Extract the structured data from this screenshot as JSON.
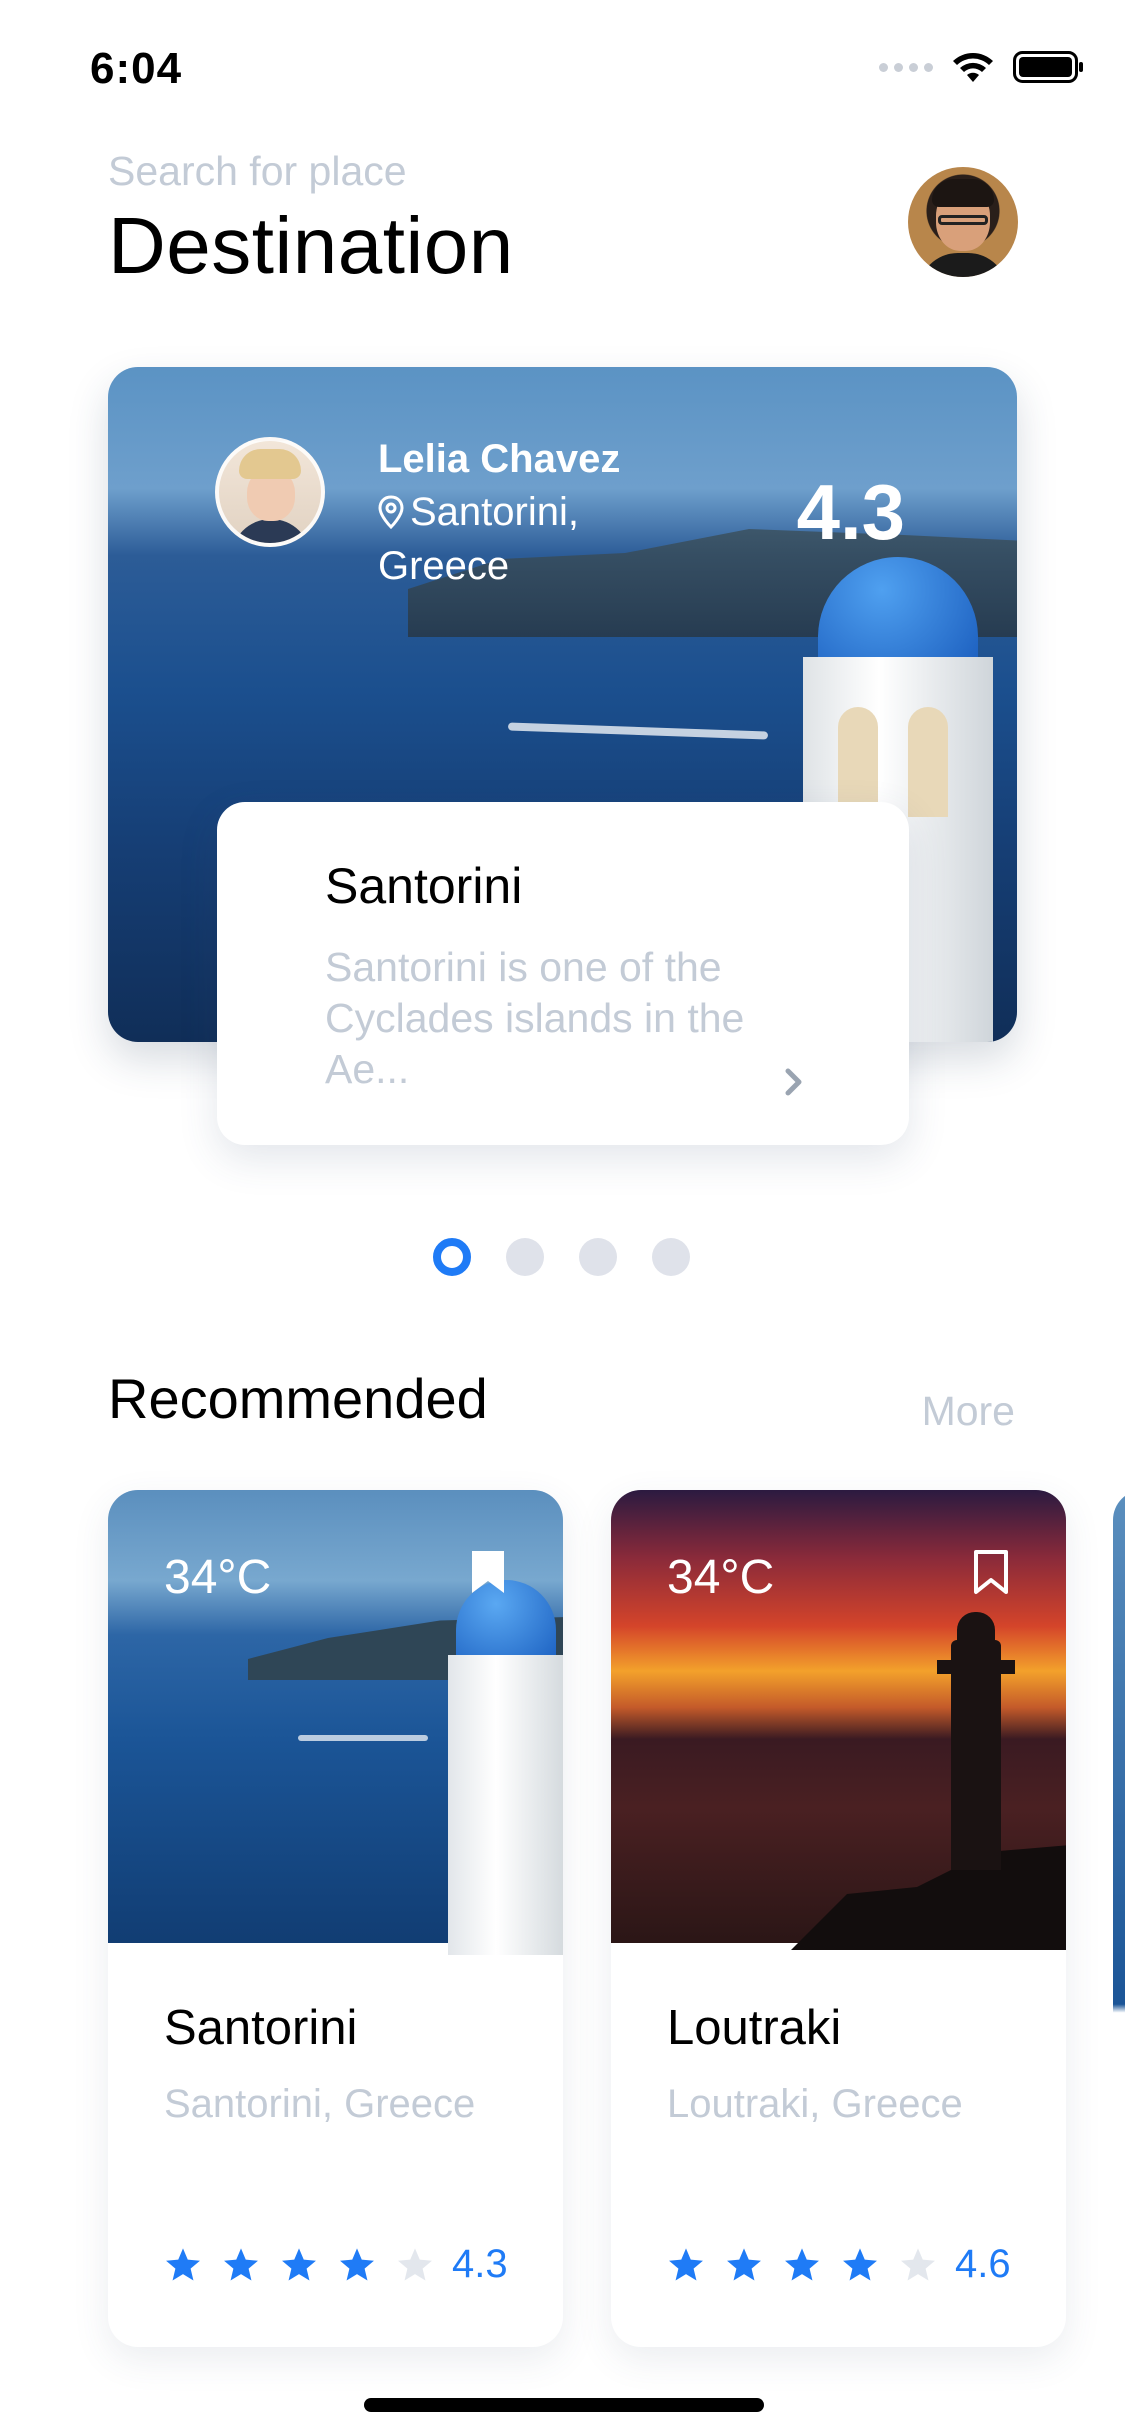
{
  "status_bar": {
    "time": "6:04"
  },
  "header": {
    "search_hint": "Search for place",
    "title": "Destination"
  },
  "featured": {
    "author_name": "Lelia Chavez",
    "location": "Santorini, Greece",
    "rating": "4.3",
    "card_title": "Santorini",
    "card_description": "Santorini is one of the Cyclades islands in the Ae...",
    "page_count": 4,
    "active_page": 1
  },
  "recommended": {
    "heading": "Recommended",
    "more_label": "More",
    "items": [
      {
        "temperature": "34°C",
        "name": "Santorini",
        "location": "Santorini, Greece",
        "rating_text": "4.3",
        "stars_filled": 4,
        "bookmarked": true
      },
      {
        "temperature": "34°C",
        "name": "Loutraki",
        "location": "Loutraki, Greece",
        "rating_text": "4.6",
        "stars_filled": 4,
        "bookmarked": false
      }
    ]
  },
  "colors": {
    "accent": "#1f7bf6",
    "muted_text": "#c3cbd6",
    "inactive_dot": "#dfe2ea"
  },
  "icons": [
    "wifi-icon",
    "battery-icon",
    "location-pin-icon",
    "chevron-right-icon",
    "bookmark-icon",
    "star-icon"
  ]
}
